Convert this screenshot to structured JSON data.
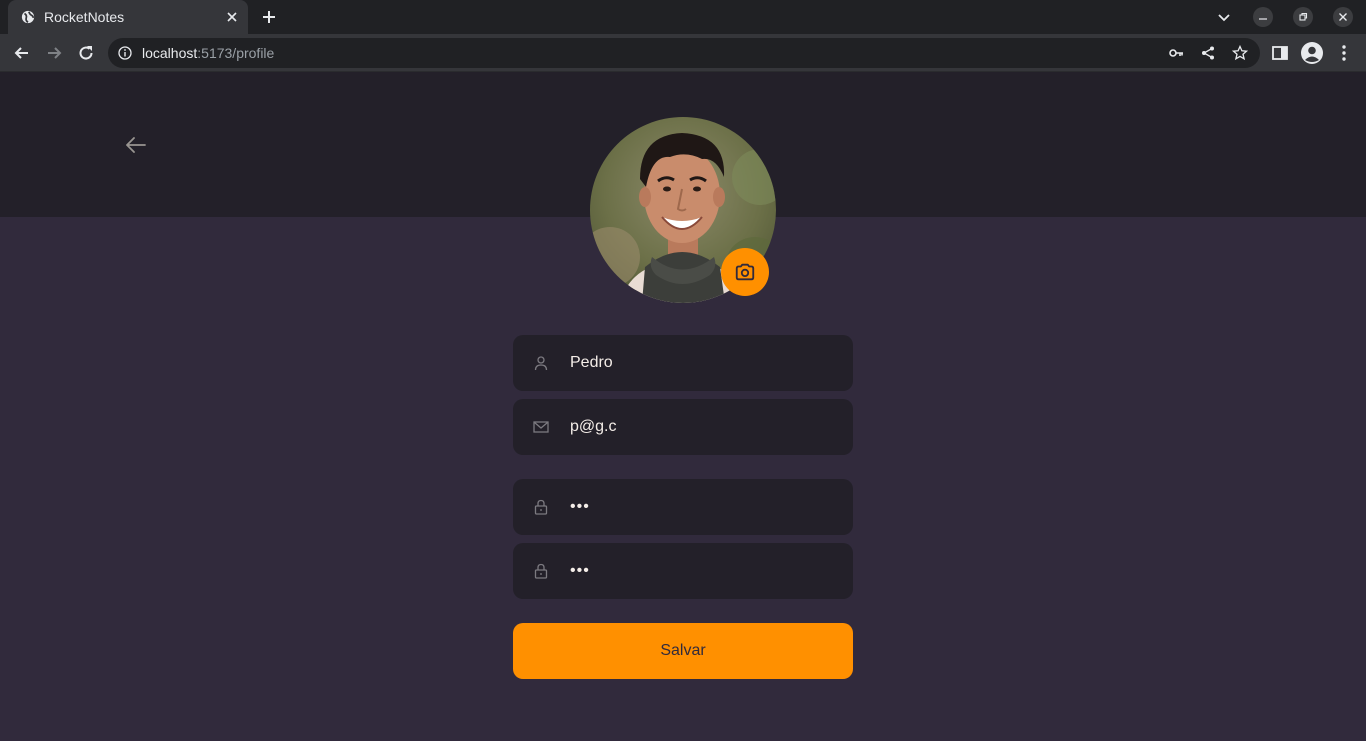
{
  "browser": {
    "tab_title": "RocketNotes",
    "url_host": "localhost",
    "url_rest": ":5173/profile"
  },
  "profile": {
    "name_value": "Pedro",
    "email_value": "p@g.c",
    "old_password_value": "123",
    "new_password_value": "123",
    "save_label": "Salvar"
  },
  "colors": {
    "accent": "#ff9000",
    "background": "#312a3c",
    "header": "#232029",
    "input_bg": "#232029",
    "text": "#f4ede8"
  }
}
